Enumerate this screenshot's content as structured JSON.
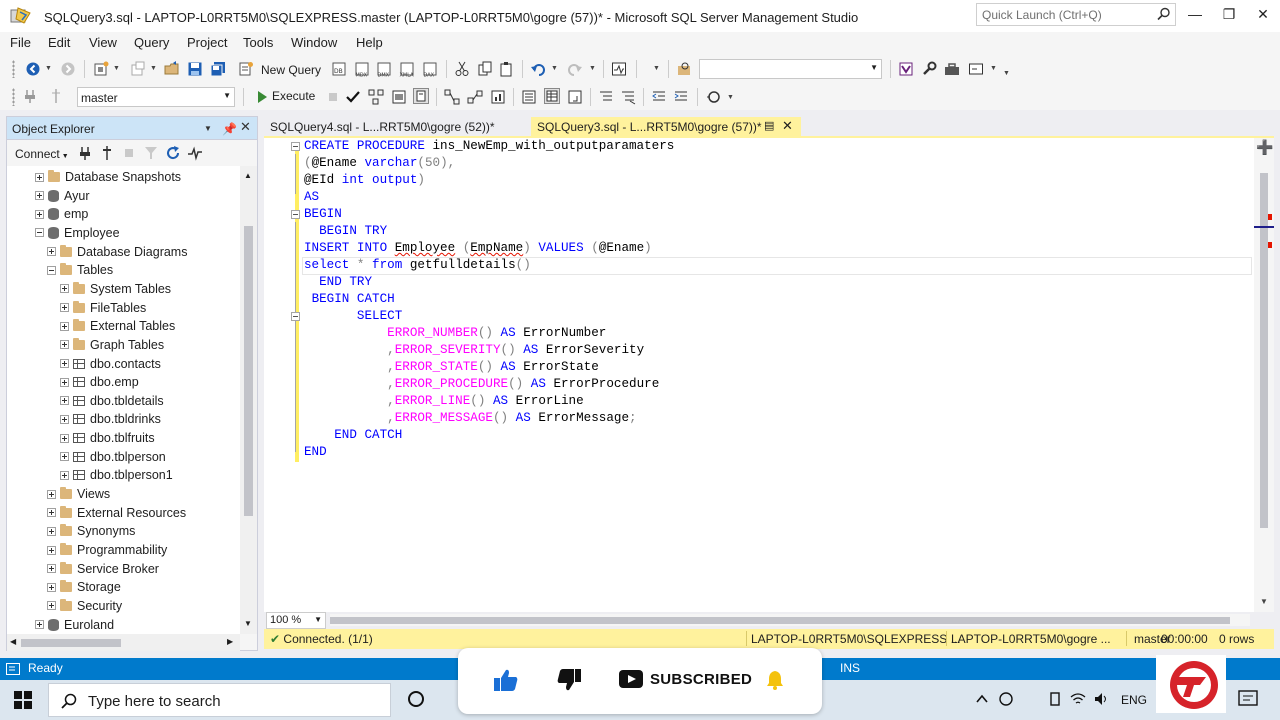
{
  "window": {
    "title": "SQLQuery3.sql - LAPTOP-L0RRT5M0\\SQLEXPRESS.master (LAPTOP-L0RRT5M0\\gogre (57))* - Microsoft SQL Server Management Studio",
    "quick_launch_placeholder": "Quick Launch (Ctrl+Q)"
  },
  "menu": [
    "File",
    "Edit",
    "View",
    "Query",
    "Project",
    "Tools",
    "Window",
    "Help"
  ],
  "toolbar": {
    "new_query": "New Query",
    "database": "master",
    "execute": "Execute"
  },
  "object_explorer": {
    "title": "Object Explorer",
    "connect": "Connect",
    "tree": [
      {
        "label": "Database Snapshots",
        "level": 0,
        "icon": "folder",
        "state": "plus"
      },
      {
        "label": "Ayur",
        "level": 0,
        "icon": "database",
        "state": "plus"
      },
      {
        "label": "emp",
        "level": 0,
        "icon": "database",
        "state": "plus"
      },
      {
        "label": "Employee",
        "level": 0,
        "icon": "database",
        "state": "minus"
      },
      {
        "label": "Database Diagrams",
        "level": 1,
        "icon": "folder",
        "state": "plus"
      },
      {
        "label": "Tables",
        "level": 1,
        "icon": "folder",
        "state": "minus"
      },
      {
        "label": "System Tables",
        "level": 2,
        "icon": "folder",
        "state": "plus"
      },
      {
        "label": "FileTables",
        "level": 2,
        "icon": "folder",
        "state": "plus"
      },
      {
        "label": "External Tables",
        "level": 2,
        "icon": "folder",
        "state": "plus"
      },
      {
        "label": "Graph Tables",
        "level": 2,
        "icon": "folder",
        "state": "plus"
      },
      {
        "label": "dbo.contacts",
        "level": 2,
        "icon": "table",
        "state": "plus"
      },
      {
        "label": "dbo.emp",
        "level": 2,
        "icon": "table",
        "state": "plus"
      },
      {
        "label": "dbo.tbldetails",
        "level": 2,
        "icon": "table",
        "state": "plus"
      },
      {
        "label": "dbo.tbldrinks",
        "level": 2,
        "icon": "table",
        "state": "plus"
      },
      {
        "label": "dbo.tblfruits",
        "level": 2,
        "icon": "table",
        "state": "plus"
      },
      {
        "label": "dbo.tblperson",
        "level": 2,
        "icon": "table",
        "state": "plus"
      },
      {
        "label": "dbo.tblperson1",
        "level": 2,
        "icon": "table",
        "state": "plus"
      },
      {
        "label": "Views",
        "level": 1,
        "icon": "folder",
        "state": "plus"
      },
      {
        "label": "External Resources",
        "level": 1,
        "icon": "folder",
        "state": "plus"
      },
      {
        "label": "Synonyms",
        "level": 1,
        "icon": "folder",
        "state": "plus"
      },
      {
        "label": "Programmability",
        "level": 1,
        "icon": "folder",
        "state": "plus"
      },
      {
        "label": "Service Broker",
        "level": 1,
        "icon": "folder",
        "state": "plus"
      },
      {
        "label": "Storage",
        "level": 1,
        "icon": "folder",
        "state": "plus"
      },
      {
        "label": "Security",
        "level": 1,
        "icon": "folder",
        "state": "plus"
      },
      {
        "label": "Euroland",
        "level": 0,
        "icon": "database",
        "state": "plus"
      }
    ]
  },
  "tabs": {
    "inactive": "SQLQuery4.sql - L...RRT5M0\\gogre (52))*",
    "active": "SQLQuery3.sql - L...RRT5M0\\gogre (57))*"
  },
  "code": {
    "l1_kw": "CREATE PROCEDURE",
    "l1_name": " ins_NewEmp_with_outputparamaters",
    "l2_open": "(",
    "l2_param": "@Ename",
    "l2_type": "varchar",
    "l2_size": "(50),",
    "l3_param": "@EId",
    "l3_type": "int",
    "l3_out": "output",
    "l3_close": ")",
    "l4": "AS",
    "l5": "BEGIN",
    "l6": "BEGIN TRY",
    "l7_kw": "INSERT INTO",
    "l7_table": "Employee",
    "l7_col": "EmpName",
    "l7_values": "VALUES",
    "l7_param": "@Ename",
    "l8_select": "select",
    "l8_star": "*",
    "l8_from": "from",
    "l8_fn": "getfulldetails",
    "l8_parens": "()",
    "l9": "END TRY",
    "l10": "BEGIN CATCH",
    "l11": "SELECT",
    "l12_fn": "ERROR_NUMBER",
    "l12_alias": "ErrorNumber",
    "l13_fn": "ERROR_SEVERITY",
    "l13_alias": "ErrorSeverity",
    "l14_fn": "ERROR_STATE",
    "l14_alias": "ErrorState",
    "l15_fn": "ERROR_PROCEDURE",
    "l15_alias": "ErrorProcedure",
    "l16_fn": "ERROR_LINE",
    "l16_alias": "ErrorLine",
    "l17_fn": "ERROR_MESSAGE",
    "l17_alias": "ErrorMessage",
    "as": "AS",
    "comma": ",",
    "parens": "()",
    "semicolon": ";",
    "l18": "END CATCH",
    "l19": "END"
  },
  "zoom": "100 %",
  "query_status": {
    "connected": "Connected. (1/1)",
    "server": "LAPTOP-L0RRT5M0\\SQLEXPRESS ...",
    "user": "LAPTOP-L0RRT5M0\\gogre ...",
    "database": "master",
    "time": "00:00:00",
    "rows": "0 rows"
  },
  "status": {
    "ready": "Ready",
    "ins": "INS"
  },
  "taskbar": {
    "search_placeholder": "Type here to search",
    "language": "ENG"
  },
  "overlay": {
    "subscribe": "SUBSCRIBED"
  },
  "colors": {
    "status_blue": "#007acc",
    "tab_active": "#fff29d",
    "keyword": "#0000ff",
    "function": "#ff00ff"
  }
}
